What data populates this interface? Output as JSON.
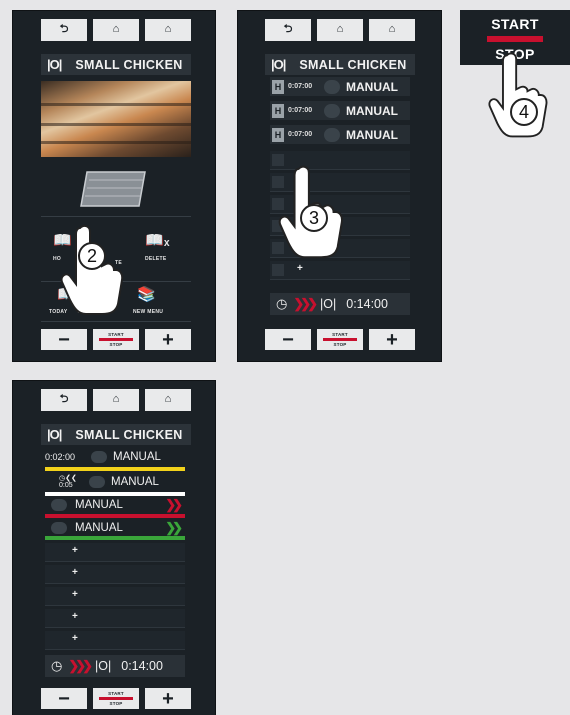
{
  "nav_icons": {
    "back": "back-arrow-icon",
    "home": "home-icon",
    "up": "up-house-icon"
  },
  "panel1": {
    "title": "SMALL CHICKEN",
    "menu_labels": {
      "home": "HO",
      "edit": "TE",
      "delete": "DELETE",
      "today": "TODAY",
      "today_rest": "MENU",
      "new_menu": "NEW MENU"
    },
    "bottom": {
      "minus": "−",
      "start": "START",
      "stop": "STOP",
      "plus": "+"
    }
  },
  "panel2": {
    "title": "SMALL CHICKEN",
    "steps": [
      {
        "time": "0:07:00",
        "mode": "MANUAL"
      },
      {
        "time": "0:07:00",
        "mode": "MANUAL"
      },
      {
        "time": "0:07:00",
        "mode": "MANUAL"
      }
    ],
    "plus": "+",
    "total_time": "0:14:00",
    "bottom": {
      "minus": "−",
      "start": "START",
      "stop": "STOP",
      "plus": "+"
    }
  },
  "panel3": {
    "title": "SMALL CHICKEN",
    "rows": [
      {
        "time": "0:02:00",
        "mode": "MANUAL",
        "line_color": "#f2d21b"
      },
      {
        "time": "0:05",
        "mode": "MANUAL",
        "line_color": "#ffffff"
      },
      {
        "mode": "MANUAL",
        "line_color": "#c8102e"
      },
      {
        "mode": "MANUAL",
        "line_color": "#3aa63a"
      }
    ],
    "plus": "+",
    "total_time": "0:14:00",
    "bottom": {
      "minus": "−",
      "start": "START",
      "stop": "STOP",
      "plus": "+"
    }
  },
  "start_stop_button": {
    "start": "START",
    "stop": "STOP"
  },
  "callouts": {
    "step2": "2",
    "step3": "3",
    "step4": "4"
  },
  "colors": {
    "panel": "#1b2126",
    "accent_red": "#c8102e",
    "green": "#3aa63a",
    "yellow": "#f2d21b"
  }
}
